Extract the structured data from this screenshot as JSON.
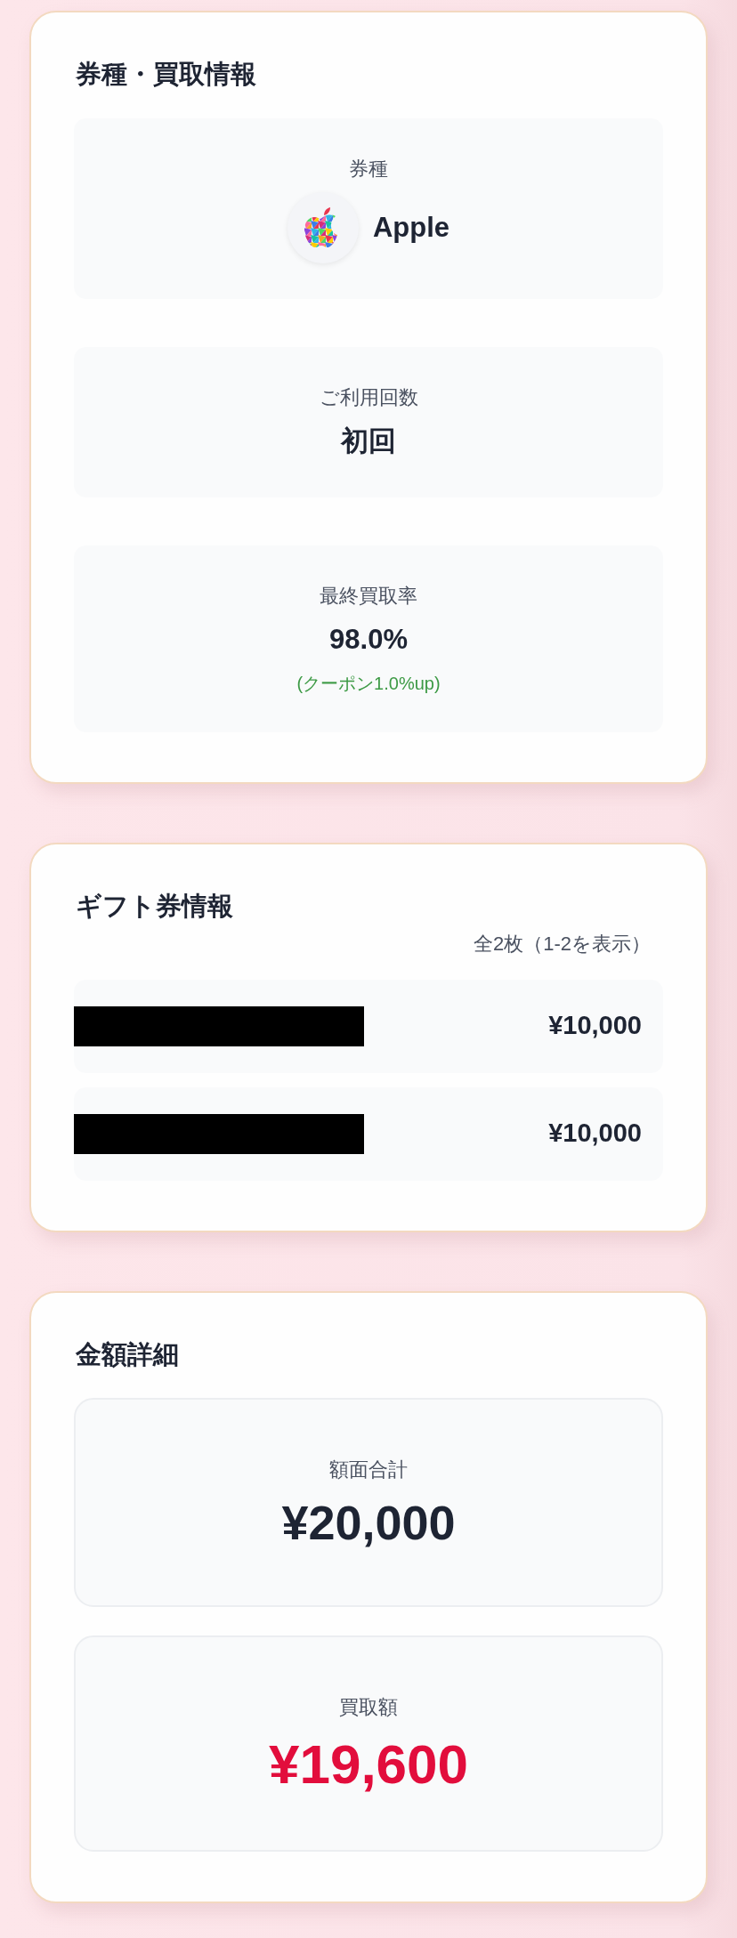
{
  "ticket_info": {
    "title": "券種・買取情報",
    "items": [
      {
        "kind": "brand",
        "label": "券種",
        "value": "Apple"
      },
      {
        "kind": "plain",
        "label": "ご利用回数",
        "value": "初回"
      },
      {
        "kind": "rate",
        "label": "最終買取率",
        "value": "98.0%",
        "note": "(クーポン1.0%up)"
      }
    ]
  },
  "gift_cards": {
    "title": "ギフト券情報",
    "count": "全2枚（1-2を表示）",
    "rows": [
      {
        "code_hidden": true,
        "amount": "¥10,000"
      },
      {
        "code_hidden": true,
        "amount": "¥10,000"
      }
    ]
  },
  "amount_details": {
    "title": "金額詳細",
    "items": [
      {
        "kind": "total",
        "label": "額面合計",
        "value": "¥20,000"
      },
      {
        "kind": "payout",
        "label": "買取額",
        "value": "¥19,600"
      }
    ]
  }
}
